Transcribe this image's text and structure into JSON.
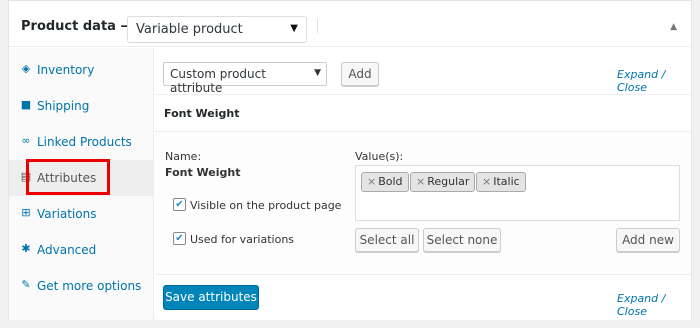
{
  "header": {
    "label": "Product data —",
    "product_type": "Variable product"
  },
  "sidebar": {
    "items": [
      {
        "label": "Inventory",
        "icon": "inventory-icon"
      },
      {
        "label": "Shipping",
        "icon": "truck-icon"
      },
      {
        "label": "Linked Products",
        "icon": "link-icon"
      },
      {
        "label": "Attributes",
        "icon": "list-icon"
      },
      {
        "label": "Variations",
        "icon": "grid-icon"
      },
      {
        "label": "Advanced",
        "icon": "gear-icon"
      },
      {
        "label": "Get more options",
        "icon": "plugin-icon"
      }
    ],
    "active": "Attributes"
  },
  "toolbar": {
    "attribute_select": "Custom product attribute",
    "add_label": "Add",
    "expand_close": "Expand / Close"
  },
  "attribute": {
    "title": "Font Weight",
    "name_label": "Name:",
    "name_value": "Font Weight",
    "values_label": "Value(s):",
    "values": [
      "Bold",
      "Regular",
      "Italic"
    ],
    "visible_label": "Visible on the product page",
    "variations_label": "Used for variations",
    "select_all": "Select all",
    "select_none": "Select none",
    "add_new": "Add new"
  },
  "footer": {
    "save_label": "Save attributes",
    "expand_close": "Expand / Close"
  },
  "colors": {
    "accent": "#0073aa",
    "primary_button": "#0085ba",
    "highlight": "#ee0000"
  }
}
